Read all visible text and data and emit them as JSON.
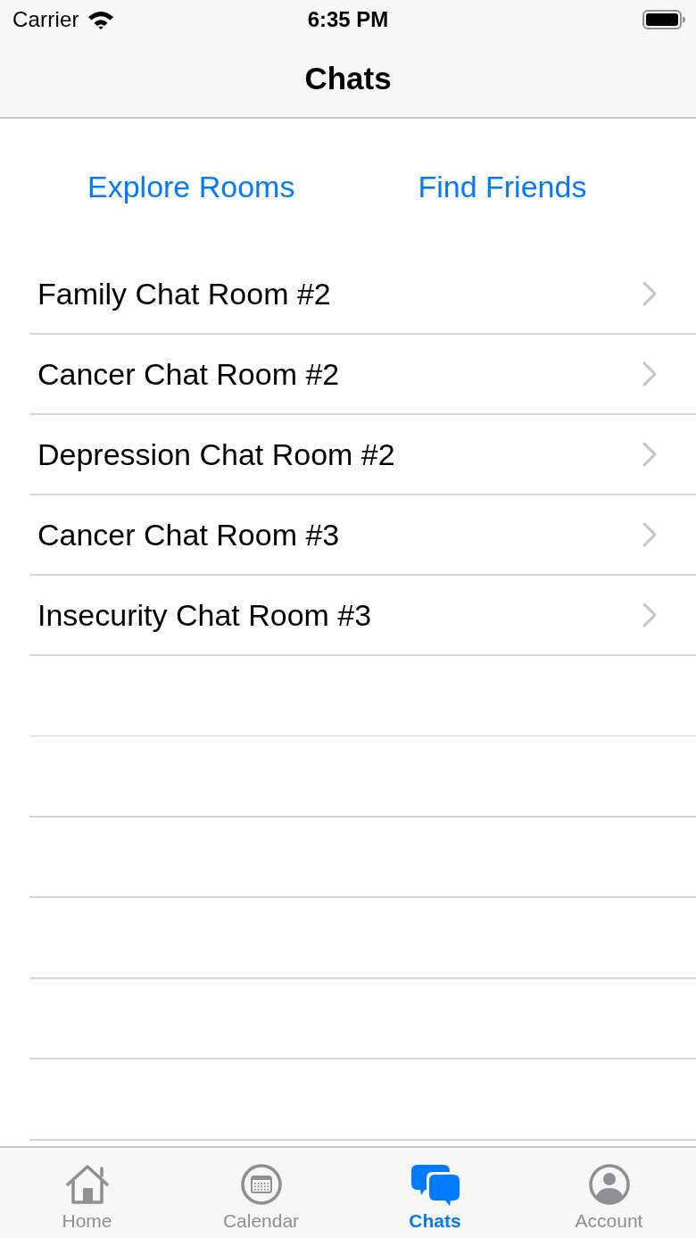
{
  "status_bar": {
    "carrier": "Carrier",
    "time": "6:35 PM"
  },
  "nav_bar": {
    "title": "Chats"
  },
  "actions": [
    {
      "label": "Explore Rooms"
    },
    {
      "label": "Find Friends"
    }
  ],
  "rooms": [
    {
      "name": "Family Chat Room #2"
    },
    {
      "name": "Cancer Chat Room #2"
    },
    {
      "name": "Depression Chat Room #2"
    },
    {
      "name": "Cancer Chat Room #3"
    },
    {
      "name": "Insecurity Chat Room #3"
    }
  ],
  "tab_bar": [
    {
      "label": "Home",
      "kind": "home",
      "selected": false
    },
    {
      "label": "Calendar",
      "kind": "calendar",
      "selected": false
    },
    {
      "label": "Chats",
      "kind": "chats",
      "selected": true
    },
    {
      "label": "Account",
      "kind": "account",
      "selected": false
    }
  ]
}
